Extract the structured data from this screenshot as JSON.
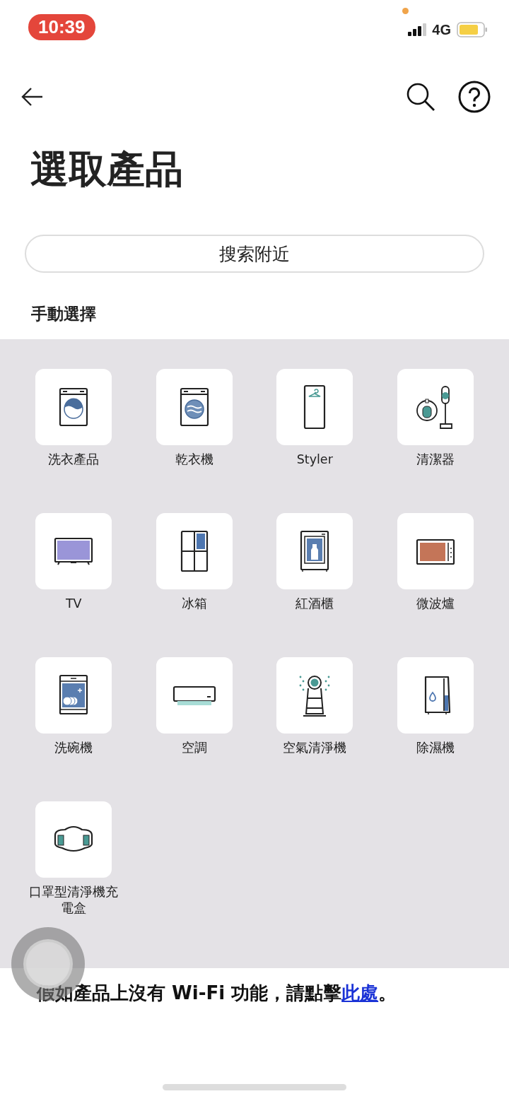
{
  "status_bar": {
    "time": "10:39",
    "network": "4G"
  },
  "header": {
    "title": "選取產品"
  },
  "search_nearby": {
    "label": "搜索附近"
  },
  "section_title": "手動選擇",
  "products": [
    {
      "label": "洗衣產品",
      "kind": "washer"
    },
    {
      "label": "乾衣機",
      "kind": "dryer"
    },
    {
      "label": "Styler",
      "kind": "styler"
    },
    {
      "label": "清潔器",
      "kind": "cleaner"
    },
    {
      "label": "TV",
      "kind": "tv"
    },
    {
      "label": "冰箱",
      "kind": "fridge"
    },
    {
      "label": "紅酒櫃",
      "kind": "wine"
    },
    {
      "label": "微波爐",
      "kind": "microwave"
    },
    {
      "label": "洗碗機",
      "kind": "dishwasher"
    },
    {
      "label": "空調",
      "kind": "aircon"
    },
    {
      "label": "空氣清淨機",
      "kind": "purifier"
    },
    {
      "label": "除濕機",
      "kind": "dehumidifier"
    },
    {
      "label": "口罩型清淨機充電盒",
      "kind": "mask"
    }
  ],
  "footer": {
    "prefix": "假如產品上沒有 Wi-Fi 功能，請點擊",
    "link": "此處",
    "suffix": "。"
  }
}
